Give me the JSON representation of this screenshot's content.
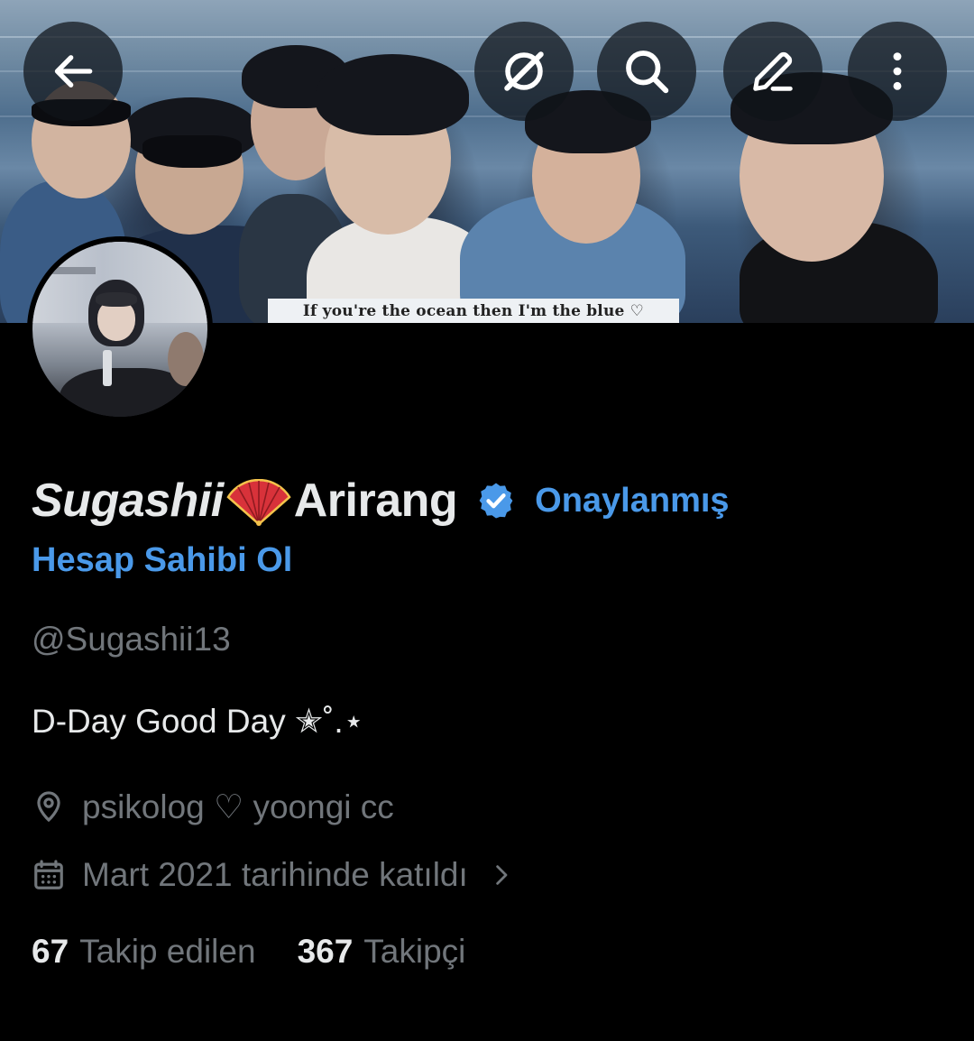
{
  "banner": {
    "caption": "If you're the ocean then I'm the blue ♡"
  },
  "toolbar": {
    "back_icon": "arrow-left-icon",
    "grok_icon": "grok-icon",
    "search_icon": "search-icon",
    "edit_icon": "pencil-icon",
    "more_icon": "more-vertical-icon"
  },
  "profile": {
    "display_name_part1": "Sugashii",
    "display_name_emoji": "folding-fan-emoji",
    "display_name_part2": "Arirang",
    "verified_label": "Onaylanmış",
    "owner_link": "Hesap Sahibi Ol",
    "handle": "@Sugashii13",
    "bio": "D-Day Good Day ✭˚.⋆",
    "location": "psikolog ♡ yoongi cc",
    "joined": "Mart 2021 tarihinde katıldı",
    "following_count": "67",
    "following_label": "Takip edilen",
    "followers_count": "367",
    "followers_label": "Takipçi"
  },
  "colors": {
    "background": "#000000",
    "accent": "#4a99e9",
    "primary_text": "#e7e9ea",
    "secondary_text": "#71767b"
  }
}
